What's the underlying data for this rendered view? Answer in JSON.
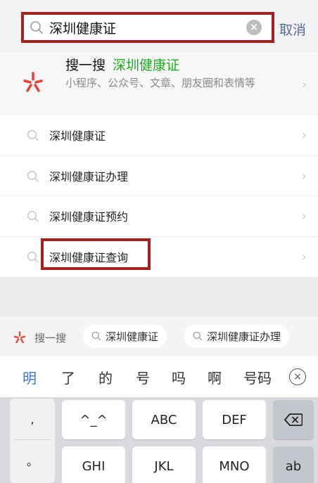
{
  "search": {
    "value": "深圳健康证",
    "cancel_label": "取消"
  },
  "sousou": {
    "title": "搜一搜",
    "keyword": "深圳健康证",
    "description": "小程序、公众号、文章、朋友圈和表情等"
  },
  "suggestions": [
    {
      "label": "深圳健康证"
    },
    {
      "label": "深圳健康证办理"
    },
    {
      "label": "深圳健康证预约"
    },
    {
      "label": "深圳健康证查询"
    }
  ],
  "related": {
    "label": "搜一搜",
    "chips": [
      "深圳健康证",
      "深圳健康证办理"
    ]
  },
  "ime": {
    "candidates": [
      "明",
      "了",
      "的",
      "号",
      "吗",
      "啊",
      "号码"
    ],
    "keys": {
      "comma": ",",
      "period": "。",
      "emoticon": "^_^",
      "abc": "ABC",
      "def": "DEF",
      "ghi": "GHI",
      "jkl": "JKL",
      "mno": "MNO",
      "switch": "ab"
    }
  },
  "colors": {
    "accent_red": "#a81f1f",
    "keyword_green": "#1aad19",
    "link_blue": "#576b95",
    "sousou_logo_red": "#e64340"
  }
}
